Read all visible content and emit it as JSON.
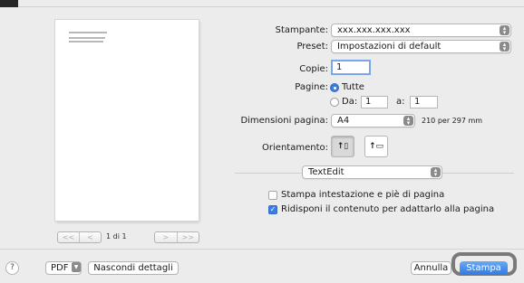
{
  "preview": {
    "nav_first": "<<",
    "nav_prev": "<",
    "nav_next": ">",
    "nav_last": ">>",
    "page_indicator": "1 di 1"
  },
  "printer": {
    "label": "Stampante:",
    "value": "xxx.xxx.xxx.xxx"
  },
  "preset": {
    "label": "Preset:",
    "value": "Impostazioni di default"
  },
  "copies": {
    "label": "Copie:",
    "value": "1"
  },
  "pages": {
    "label": "Pagine:",
    "all_label": "Tutte",
    "all_selected": true,
    "from_label": "Da:",
    "from_value": "1",
    "to_label": "a:",
    "to_value": "1"
  },
  "paper_size": {
    "label": "Dimensioni pagina:",
    "value": "A4",
    "dimensions": "210 per 297 mm"
  },
  "orientation": {
    "label": "Orientamento:",
    "selected": "portrait"
  },
  "app_section": {
    "value": "TextEdit"
  },
  "options": [
    {
      "label": "Stampa intestazione e piè di pagina",
      "checked": false
    },
    {
      "label": "Ridisponi il contenuto per adattarlo alla pagina",
      "checked": true
    }
  ],
  "footer": {
    "help_label": "?",
    "pdf_label": "PDF",
    "hide_details_label": "Nascondi dettagli",
    "cancel_label": "Annulla",
    "print_label": "Stampa"
  },
  "colors": {
    "accent": "#3b7de2",
    "highlight_ring": "#7a7a7a"
  }
}
